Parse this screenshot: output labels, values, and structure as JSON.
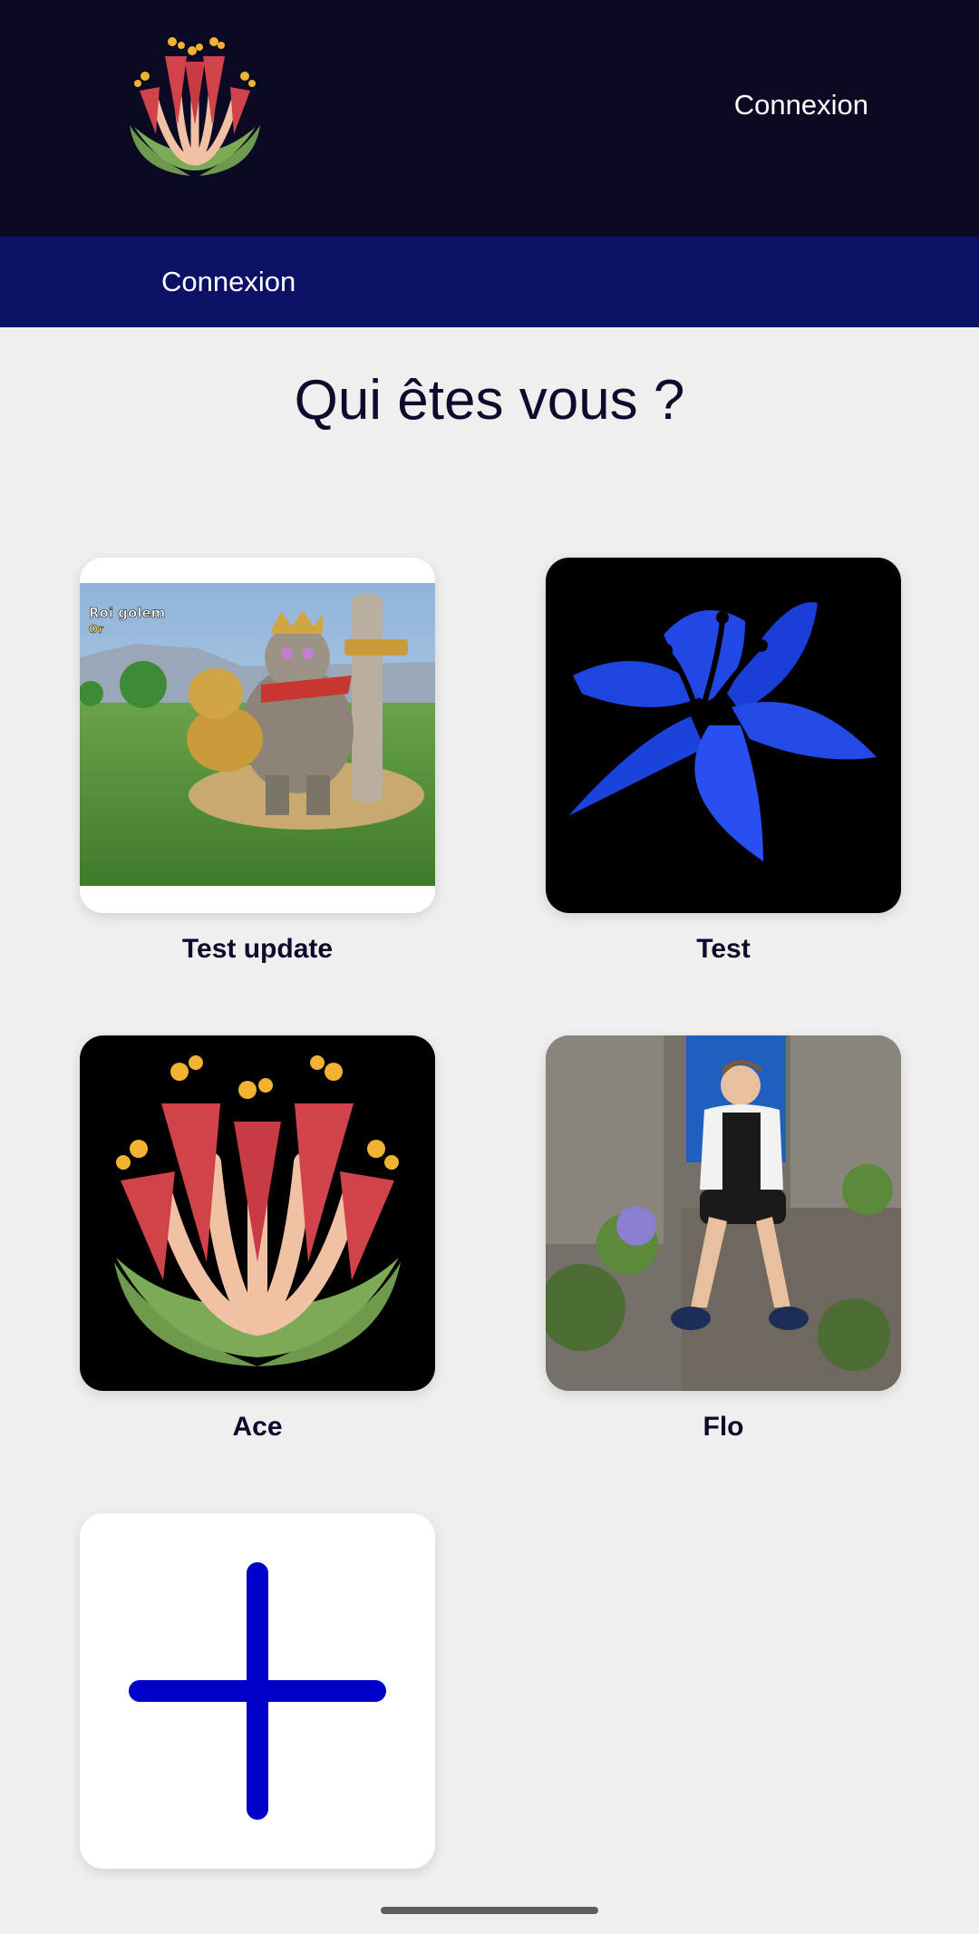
{
  "header": {
    "login_label": "Connexion"
  },
  "navbar": {
    "login_label": "Connexion"
  },
  "main": {
    "title": "Qui êtes vous ?",
    "profiles": [
      {
        "name": "Test update",
        "avatar": "clash-golem-image",
        "badge_line1": "Roi golem",
        "badge_line2": "Or"
      },
      {
        "name": "Test",
        "avatar": "blue-lily-image"
      },
      {
        "name": "Ace",
        "avatar": "red-flower-logo-image"
      },
      {
        "name": "Flo",
        "avatar": "person-photo"
      }
    ],
    "add_profile_icon": "plus-icon"
  },
  "colors": {
    "header_bg": "#0a0a24",
    "navbar_bg": "#0d1166",
    "page_bg": "#efefef",
    "accent_plus": "#0000c8",
    "title_text": "#0b0b2b"
  }
}
